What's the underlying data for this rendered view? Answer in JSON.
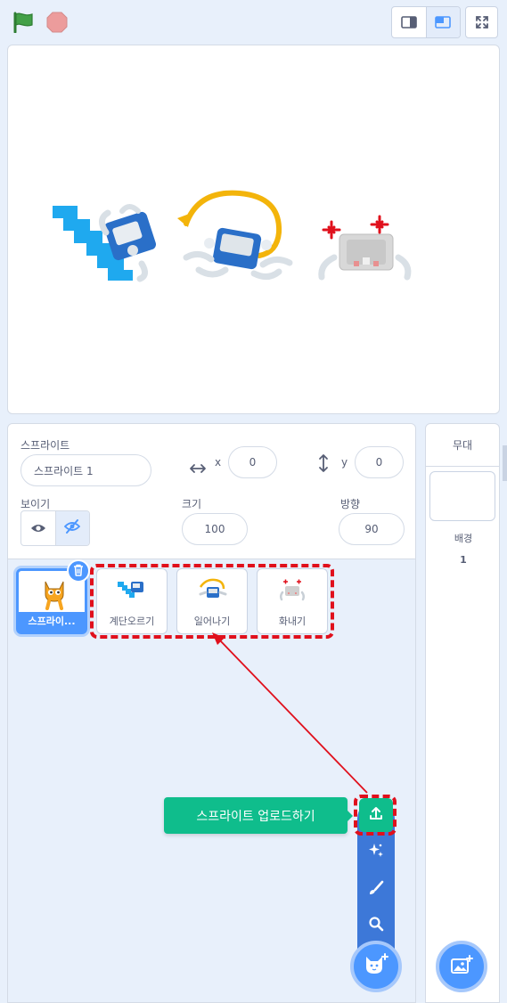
{
  "toolbar": {
    "green_flag_icon": "green-flag-icon",
    "stop_icon": "stop-icon",
    "colors": {
      "flag": "#43a047",
      "stop": "#ec9c9c"
    }
  },
  "sprite_info": {
    "sprite_label": "스프라이트",
    "sprite_name": "스프라이트 1",
    "x_label": "x",
    "x_value": "0",
    "y_label": "y",
    "y_value": "0",
    "show_label": "보이기",
    "size_label": "크기",
    "size_value": "100",
    "direction_label": "방향",
    "direction_value": "90"
  },
  "sprites": [
    {
      "name": "스프라이...",
      "selected": true
    },
    {
      "name": "계단오르기",
      "selected": false
    },
    {
      "name": "일어나기",
      "selected": false
    },
    {
      "name": "화내기",
      "selected": false
    }
  ],
  "sprite_menu": {
    "tooltip": "스프라이트 업로드하기",
    "items": [
      "upload-icon",
      "surprise-icon",
      "paint-icon",
      "search-icon"
    ]
  },
  "stage_pane": {
    "title": "무대",
    "backdrop_label": "배경",
    "backdrop_count": "1"
  },
  "colors": {
    "accent": "#4c97ff",
    "menu": "#3d78d8",
    "upload": "#0fbd8c",
    "highlight": "#e0101c"
  }
}
